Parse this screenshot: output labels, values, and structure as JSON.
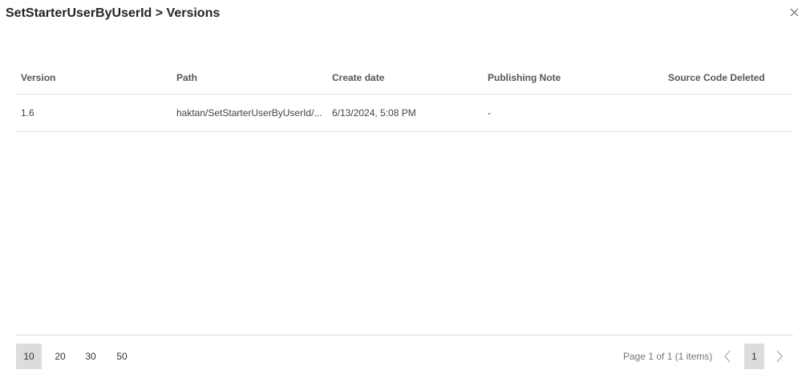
{
  "dialog": {
    "title": "SetStarterUserByUserId > Versions",
    "close_icon": "close-icon"
  },
  "table": {
    "columns": [
      "Version",
      "Path",
      "Create date",
      "Publishing Note",
      "Source Code Deleted"
    ],
    "rows": [
      {
        "version": "1.6",
        "path": "haktan/SetStarterUserByUserId/...",
        "create_date": "6/13/2024, 5:08 PM",
        "publishing_note": "-",
        "source_code_deleted": ""
      }
    ]
  },
  "pager": {
    "page_sizes": [
      "10",
      "20",
      "30",
      "50"
    ],
    "selected_page_size": "10",
    "info": "Page 1 of 1 (1 items)",
    "current_page": "1",
    "prev_icon": "chevron-left-icon",
    "next_icon": "chevron-right-icon"
  },
  "colors": {
    "selected_bg": "#dcdcdc",
    "border": "#e0e0e0"
  }
}
